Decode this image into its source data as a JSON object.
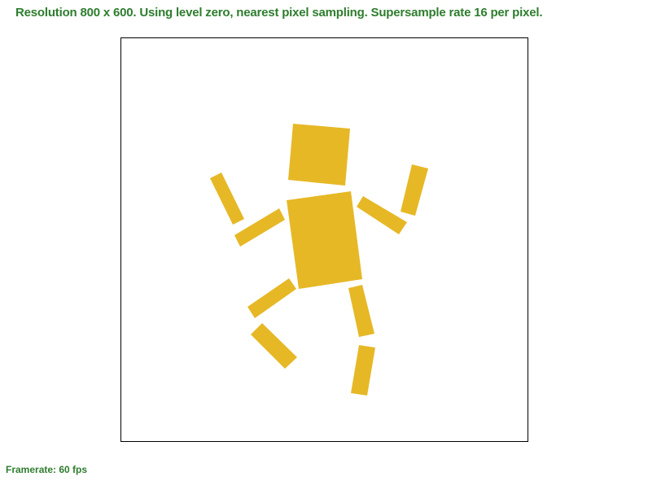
{
  "status": {
    "text": "Resolution 800 x 600. Using level zero, nearest pixel sampling. Supersample rate 16 per pixel."
  },
  "footer": {
    "framerate": "Framerate: 60 fps"
  },
  "scene": {
    "fill_color": "#e6b826",
    "border_color": "#000000",
    "text_color": "#2e7d2e"
  }
}
